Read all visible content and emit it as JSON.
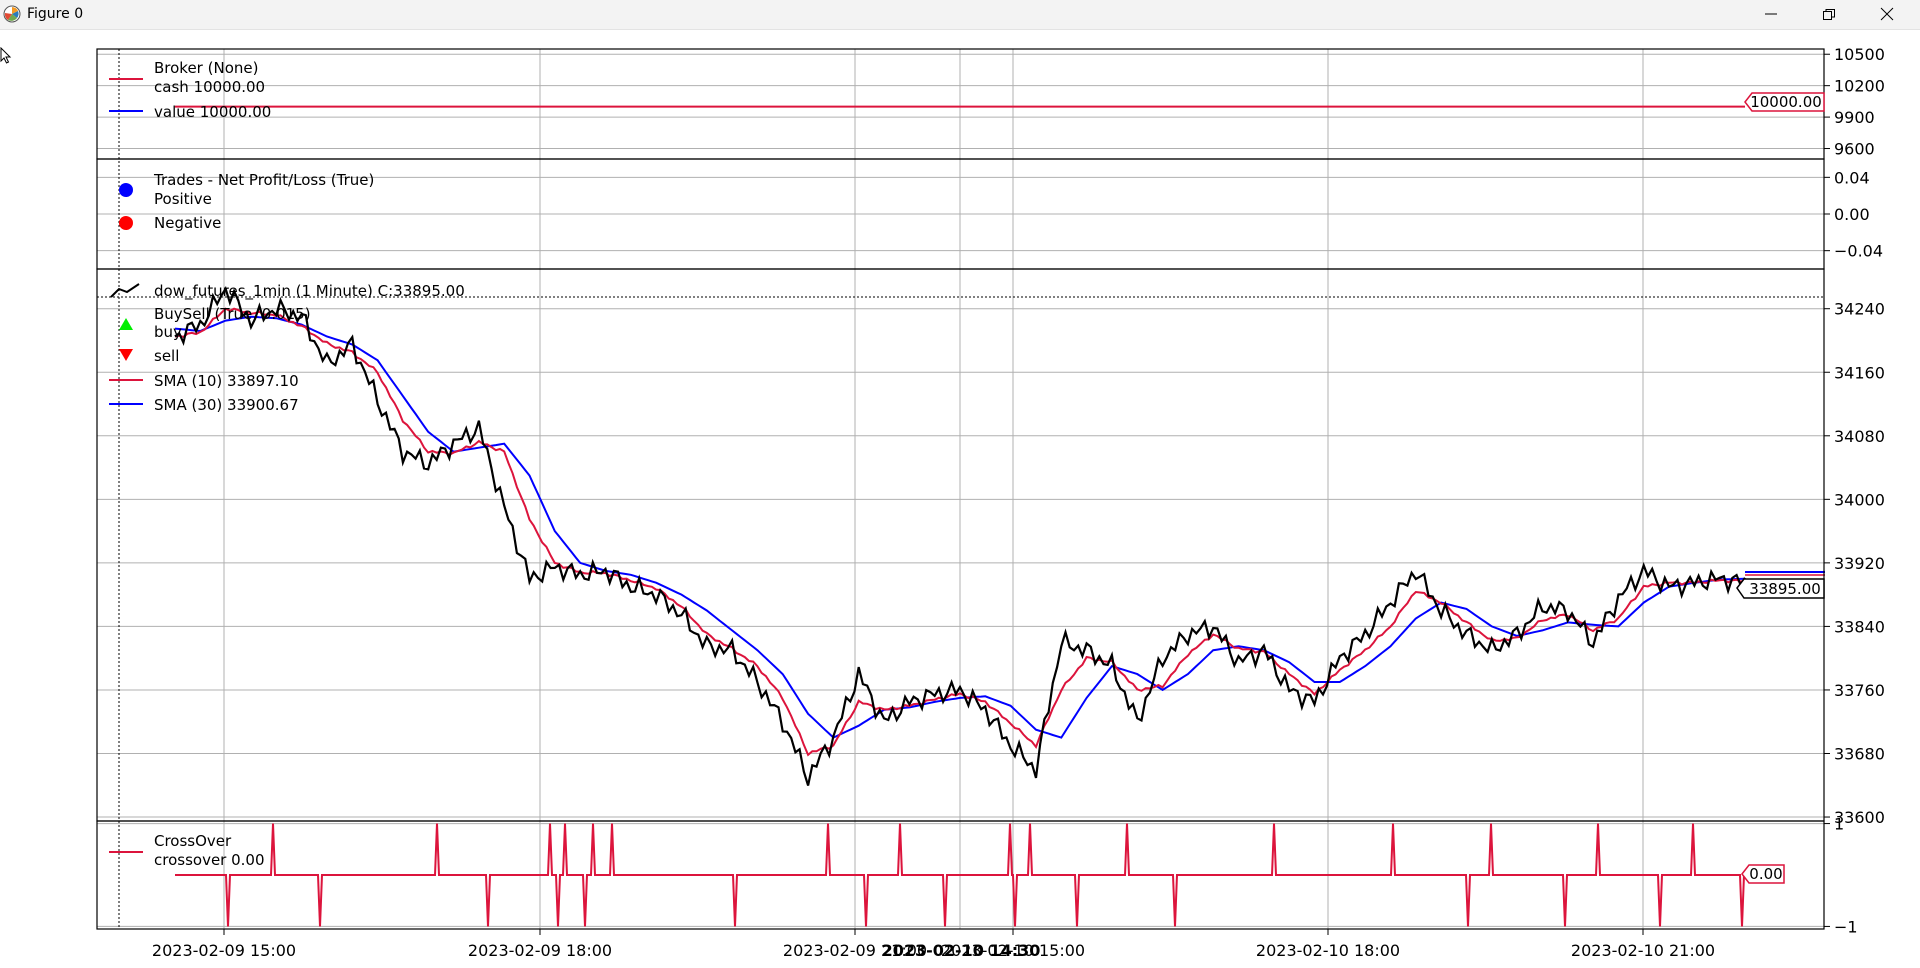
{
  "window": {
    "title": "Figure 0",
    "icons": {
      "app": "matplotlib-icon",
      "minimize": "minimize-icon",
      "maximize": "restore-icon",
      "close": "close-icon",
      "cursor": "mouse-pointer-icon"
    }
  },
  "colors": {
    "black": "#000000",
    "blue": "#0000ff",
    "crimson": "#dc143c",
    "red": "#ff0000",
    "lime": "#00ee00",
    "grid": "#b0b0b0",
    "buyblue": "#0000ff"
  },
  "panels": {
    "broker": {
      "legend": [
        "Broker (None)",
        "cash 10000.00",
        "value 10000.00"
      ],
      "ticks": [
        "10500",
        "10200",
        "9900",
        "9600"
      ],
      "value_tag": "10000.00"
    },
    "trades": {
      "legend": [
        "Trades - Net Profit/Loss (True)",
        "Positive",
        "Negative"
      ],
      "ticks": [
        "0.04",
        "0.00",
        "−0.04"
      ]
    },
    "price": {
      "legend": [
        "dow_futures_1min (1 Minute) C:33895.00",
        "BuySell (True, 0.015)",
        "buy",
        "sell",
        "SMA (10) 33897.10",
        "SMA (30) 33900.67"
      ],
      "ticks": [
        "34240",
        "34160",
        "34080",
        "34000",
        "33920",
        "33840",
        "33760",
        "33680",
        "33600"
      ],
      "close_tag": "33895.00"
    },
    "crossover": {
      "legend": [
        "CrossOver",
        "crossover 0.00"
      ],
      "ticks": [
        "1",
        "−1"
      ],
      "value_tag": "0.00"
    }
  },
  "x_axis": {
    "ticks": [
      "2023-02-09 15:00",
      "2023-02-09 18:00",
      "2023-02-09 21:00",
      "2023-02-10 15:00",
      "2023-02-10 18:00",
      "2023-02-10 21:00"
    ],
    "overlay_label": "2023-02-10 14:30"
  },
  "chart_data": [
    {
      "type": "line",
      "title": "Broker (None)",
      "series": [
        {
          "name": "cash 10000.00",
          "values": [
            10000,
            10000
          ]
        },
        {
          "name": "value 10000.00",
          "values": [
            10000,
            10000
          ]
        }
      ],
      "ylim": [
        9500,
        10550
      ]
    },
    {
      "type": "scatter",
      "title": "Trades - Net Profit/Loss (True)",
      "series": [
        {
          "name": "Positive",
          "values": []
        },
        {
          "name": "Negative",
          "values": []
        }
      ],
      "ylim": [
        -0.06,
        0.06
      ]
    },
    {
      "type": "line",
      "x": [
        "2023-02-09 14:40",
        "2023-02-10 22:00"
      ],
      "series": [
        {
          "name": "dow_futures_1min (1 Minute) C:33895.00",
          "values": [
            34205,
            34220,
            34265,
            34225,
            34240,
            34230,
            34170,
            34195,
            34125,
            34060,
            34045,
            34070,
            34090,
            33990,
            33900,
            33915,
            33905,
            33910,
            33890,
            33880,
            33855,
            33815,
            33810,
            33770,
            33720,
            33650,
            33700,
            33780,
            33720,
            33745,
            33755,
            33760,
            33735,
            33690,
            33660,
            33820,
            33810,
            33790,
            33720,
            33800,
            33830,
            33840,
            33795,
            33810,
            33760,
            33745,
            33800,
            33830,
            33870,
            33910,
            33860,
            33830,
            33810,
            33830,
            33865,
            33860,
            33820,
            33875,
            33910,
            33890,
            33895,
            33900,
            33895
          ]
        },
        {
          "name": "SMA (10) 33897.10",
          "values": [
            34205,
            34210,
            34240,
            34235,
            34232,
            34218,
            34196,
            34185,
            34160,
            34100,
            34060,
            34058,
            34072,
            34060,
            33975,
            33920,
            33908,
            33907,
            33898,
            33888,
            33865,
            33830,
            33812,
            33790,
            33750,
            33680,
            33690,
            33745,
            33735,
            33740,
            33748,
            33755,
            33745,
            33718,
            33690,
            33760,
            33800,
            33795,
            33760,
            33765,
            33805,
            33830,
            33812,
            33808,
            33780,
            33755,
            33785,
            33810,
            33840,
            33885,
            33870,
            33845,
            33822,
            33825,
            33848,
            33855,
            33835,
            33850,
            33890,
            33895,
            33895,
            33898,
            33897
          ]
        },
        {
          "name": "SMA (30) 33900.67",
          "values": [
            34215,
            34212,
            34225,
            34230,
            34228,
            34220,
            34205,
            34195,
            34175,
            34130,
            34085,
            34060,
            34065,
            34070,
            34030,
            33960,
            33920,
            33910,
            33905,
            33895,
            33880,
            33860,
            33835,
            33810,
            33780,
            33730,
            33700,
            33715,
            33735,
            33738,
            33745,
            33750,
            33752,
            33740,
            33710,
            33700,
            33750,
            33790,
            33780,
            33760,
            33780,
            33810,
            33815,
            33810,
            33795,
            33770,
            33770,
            33790,
            33815,
            33850,
            33870,
            33862,
            33840,
            33828,
            33835,
            33845,
            33842,
            33840,
            33870,
            33890,
            33895,
            33899,
            33900
          ]
        }
      ],
      "ylim": [
        33595,
        34290
      ]
    },
    {
      "type": "line",
      "title": "CrossOver",
      "series": [
        {
          "name": "crossover 0.00",
          "values": [
            0,
            -1,
            1,
            -1,
            1,
            -1,
            1,
            -1,
            1,
            -1,
            1,
            1,
            -1,
            1,
            -1,
            1,
            -1,
            1,
            -1,
            1,
            -1,
            1,
            -1,
            1,
            1,
            -1,
            1,
            -1,
            1,
            -1,
            1,
            -1,
            1,
            1,
            -1,
            1,
            -1,
            1,
            -1,
            1,
            1,
            0
          ]
        }
      ],
      "ylim": [
        -1.05,
        1.05
      ]
    }
  ]
}
